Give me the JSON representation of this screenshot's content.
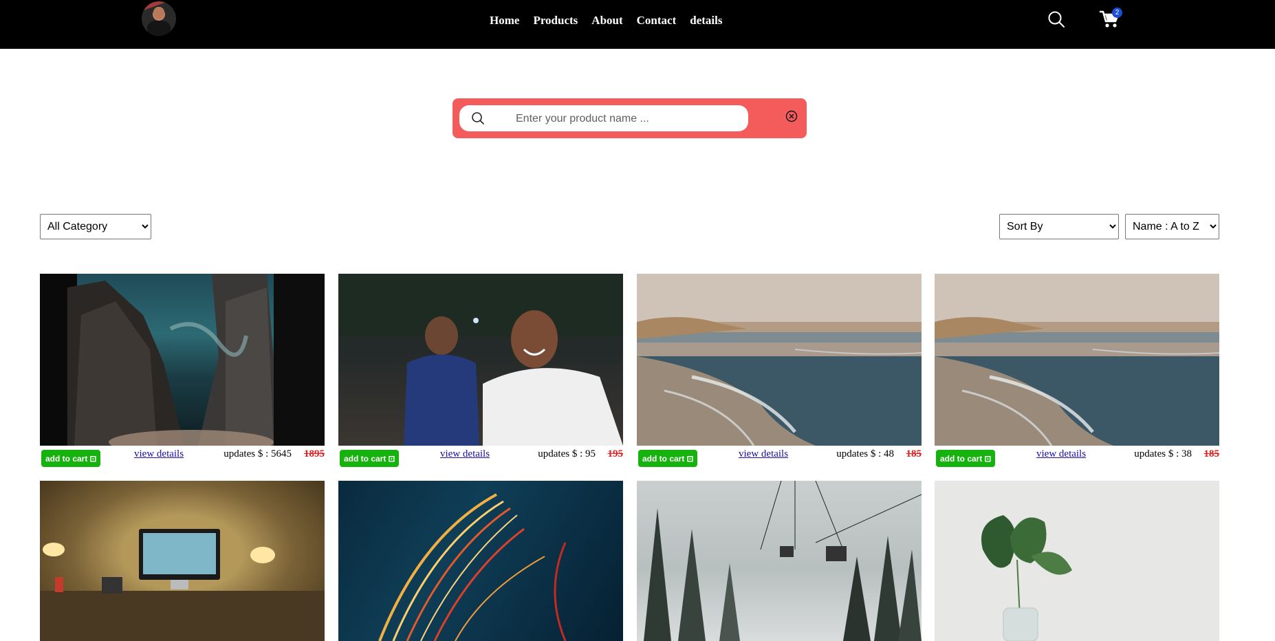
{
  "nav": {
    "links": [
      "Home",
      "Products",
      "About",
      "Contact",
      "details"
    ],
    "cart_count": "2"
  },
  "search": {
    "placeholder": "Enter your product name ..."
  },
  "filters": {
    "category_selected": "All Category",
    "sort_selected": "Sort By",
    "order_selected": "Name : A to Z"
  },
  "products": [
    {
      "add_label": "add to cart",
      "view_label": "view details",
      "price_label": "updates $ : 5645",
      "old_price": "1895"
    },
    {
      "add_label": "add to cart",
      "view_label": "view details",
      "price_label": "updates $ : 95",
      "old_price": "195"
    },
    {
      "add_label": "add to cart",
      "view_label": "view details",
      "price_label": "updates $ : 48",
      "old_price": "185"
    },
    {
      "add_label": "add to cart",
      "view_label": "view details",
      "price_label": "updates $ : 38",
      "old_price": "185"
    }
  ],
  "colors": {
    "nav_bg": "#000000",
    "search_bg": "#f45b5b",
    "cart_button": "#16b20e",
    "old_price": "#e11d1d",
    "badge": "#1d4ed8"
  }
}
